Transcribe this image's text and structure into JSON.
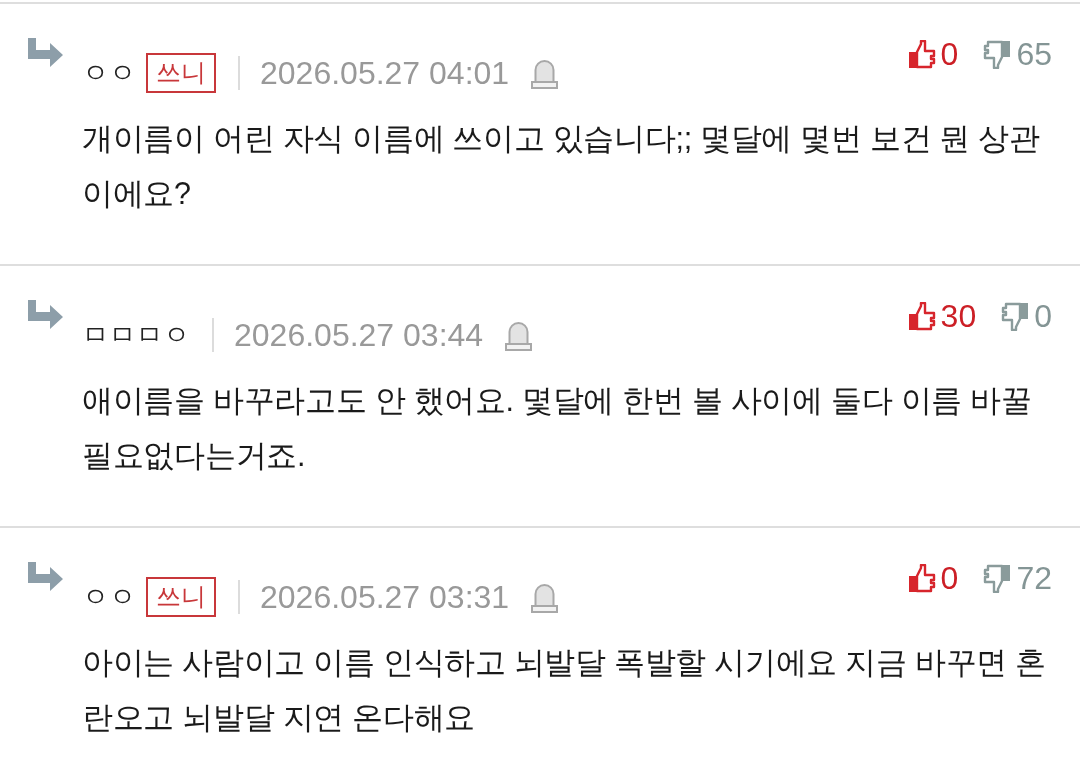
{
  "comments": [
    {
      "author": "ㅇㅇ",
      "badge": "쓰니",
      "date": "2026.05.27 04:01",
      "likes": "0",
      "dislikes": "65",
      "text": "개이름이 어린 자식 이름에 쓰이고 있습니다;; 몇달에 몇번 보건 뭔 상관이에요?"
    },
    {
      "author": "ㅁㅁㅁㅇ",
      "date": "2026.05.27 03:44",
      "likes": "30",
      "dislikes": "0",
      "text": "애이름을 바꾸라고도 안 했어요. 몇달에 한번 볼 사이에 둘다 이름 바꿀 필요없다는거죠."
    },
    {
      "author": "ㅇㅇ",
      "badge": "쓰니",
      "date": "2026.05.27 03:31",
      "likes": "0",
      "dislikes": "72",
      "text": "아이는 사람이고 이름 인식하고 뇌발달 폭발할 시기에요 지금 바꾸면 혼란오고 뇌발달 지연 온다해요"
    }
  ]
}
